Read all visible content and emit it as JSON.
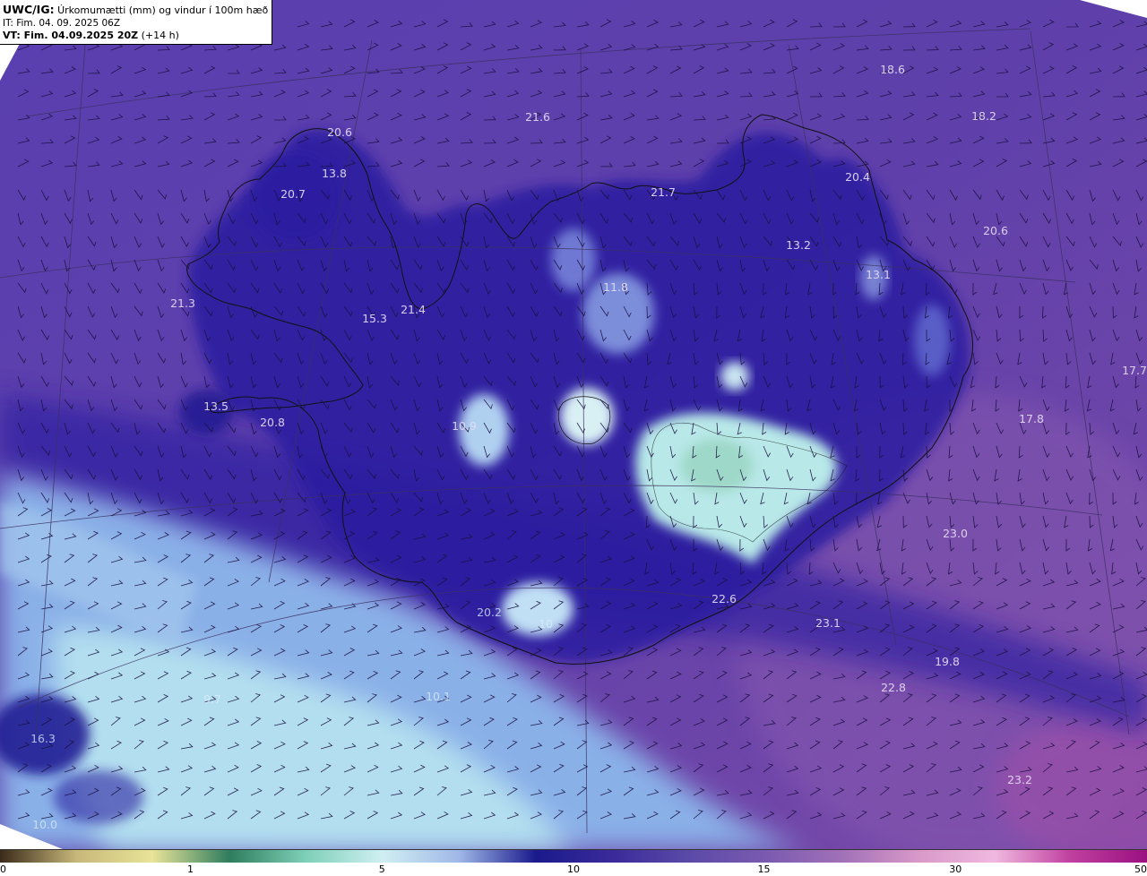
{
  "title": {
    "model": "UWC/IG:",
    "description": "Úrkomumætti (mm) og vindur í 100m hæð",
    "init_time": "IT: Fim. 04. 09. 2025 06Z",
    "valid_label": "VT: Fim. 04.09.2025 20Z",
    "lead": "(+14 h)"
  },
  "station_values": [
    "18.6",
    "21.6",
    "18.2",
    "20.6",
    "13.8",
    "20.7",
    "21.7",
    "20.4",
    "20.6",
    "13.2",
    "13.1",
    "11.8",
    "21.3",
    "15.3",
    "21.4",
    "17.7",
    "13.5",
    "20.8",
    "10.9",
    "17.8",
    "23.0",
    "22.6",
    "20.2",
    "10",
    "23.1",
    "19.8",
    "22.8",
    "9.7",
    "10.1",
    "16.3",
    "23.2",
    "10.0"
  ],
  "colorbar": {
    "tick_labels": [
      "0",
      "1",
      "5",
      "10",
      "15",
      "30",
      "50"
    ],
    "colors": [
      "#3a2a1a",
      "#c8b87a",
      "#e8e498",
      "#2e7d5e",
      "#7ed0b8",
      "#cfeff2",
      "#9fb8e8",
      "#1a1a8c",
      "#3a2a9a",
      "#5a4aa8",
      "#7a5ab0",
      "#a070b8",
      "#d898c8",
      "#f0b8e0",
      "#c040a0",
      "#9a1080"
    ],
    "tick_fractions": [
      0.0,
      0.166,
      0.333,
      0.5,
      0.666,
      0.833,
      1.0
    ]
  },
  "layers": {
    "field": "precipitable water",
    "wind_barbs": "100m wind",
    "coastline": "Iceland"
  }
}
